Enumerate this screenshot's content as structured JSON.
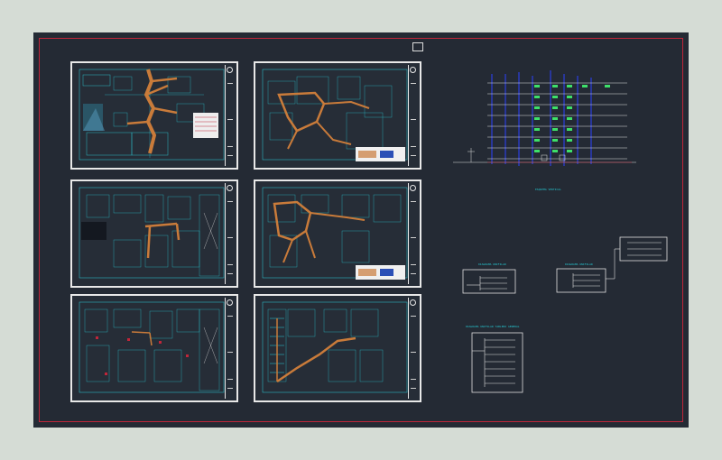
{
  "drawing": {
    "sheets": [
      {
        "id": 1,
        "has_legend": true
      },
      {
        "id": 2,
        "has_legend": true
      },
      {
        "id": 3,
        "has_legend": false
      },
      {
        "id": 4,
        "has_legend": true
      },
      {
        "id": 5,
        "has_legend": false
      },
      {
        "id": 6,
        "has_legend": false
      }
    ],
    "diagrams": [
      {
        "name": "vertical-riser-section",
        "caption": "ESQUEMA VERTICAL"
      },
      {
        "name": "single-line-diagram-left",
        "caption": "DIAGRAMA UNIFILAR"
      },
      {
        "name": "single-line-diagram-right",
        "caption": "DIAGRAMA UNIFILAR"
      },
      {
        "name": "single-line-diagram-bottom",
        "caption": "DIAGRAMA UNIFILAR TABLERO GENERAL"
      }
    ]
  },
  "colors": {
    "background": "#242a34",
    "page": "#d5dcd5",
    "frame": "#c0263a",
    "cyan_lines": "#2bb8c4",
    "orange_ducts": "#c97b3a",
    "green_fixtures": "#3ee06a",
    "blue_risers": "#2c3fe0",
    "sheet_border": "#e8e8e8"
  }
}
